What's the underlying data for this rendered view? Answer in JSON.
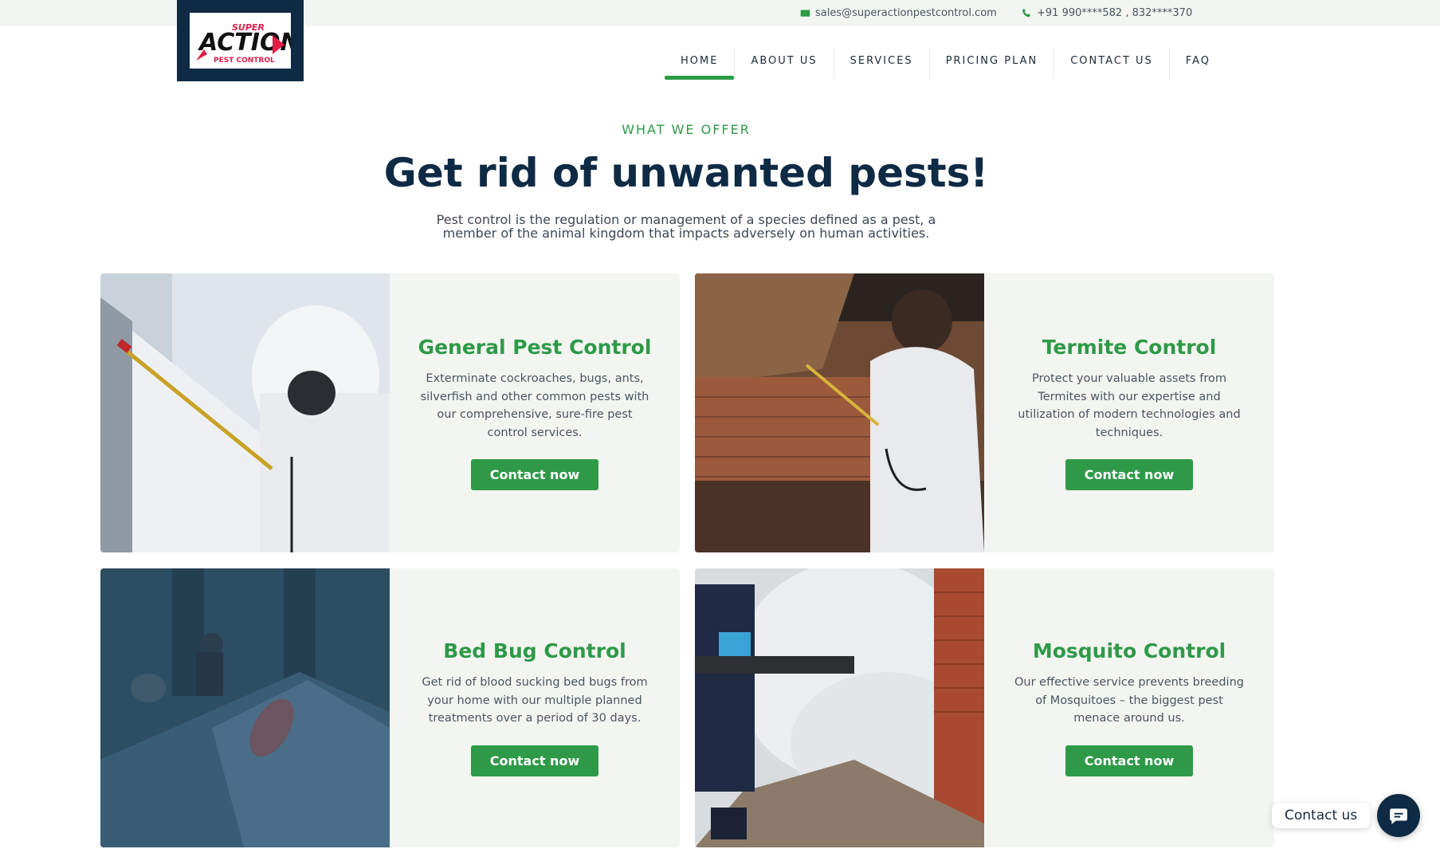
{
  "topbar": {
    "email": "sales@superactionpestcontrol.com",
    "phone": "+91 990****582 , 832****370"
  },
  "logo": {
    "top_text": "SUPER",
    "main_text": "ACTION",
    "sub_text": "PEST CONTROL"
  },
  "nav": {
    "items": [
      "HOME",
      "ABOUT US",
      "SERVICES",
      "PRICING PLAN",
      "CONTACT US",
      "FAQ"
    ],
    "active": "HOME"
  },
  "section": {
    "eyebrow": "WHAT WE OFFER",
    "title": "Get rid of unwanted pests!",
    "lead": "Pest control is the regulation or management of a species defined as a pest, a member of the animal kingdom that impacts adversely on human activities."
  },
  "services": [
    {
      "title": "General Pest Control",
      "description": "Exterminate cockroaches, bugs, ants, silverfish and other common pests with our comprehensive, sure-fire pest control services.",
      "button": "Contact now"
    },
    {
      "title": "Termite Control",
      "description": "Protect your valuable assets from Termites with our expertise and utilization of modern technologies and techniques.",
      "button": "Contact now"
    },
    {
      "title": "Bed Bug Control",
      "description": "Get rid of blood sucking bed bugs from your home with our multiple planned treatments over a period of 30 days.",
      "button": "Contact now"
    },
    {
      "title": "Mosquito Control",
      "description": "Our effective service prevents breeding of Mosquitoes – the biggest pest menace around us.",
      "button": "Contact now"
    }
  ],
  "floating_contact": {
    "label": "Contact us"
  },
  "colors": {
    "accent": "#2e9a48",
    "navy": "#0e2a44",
    "card_bg": "#f3f5f1"
  }
}
